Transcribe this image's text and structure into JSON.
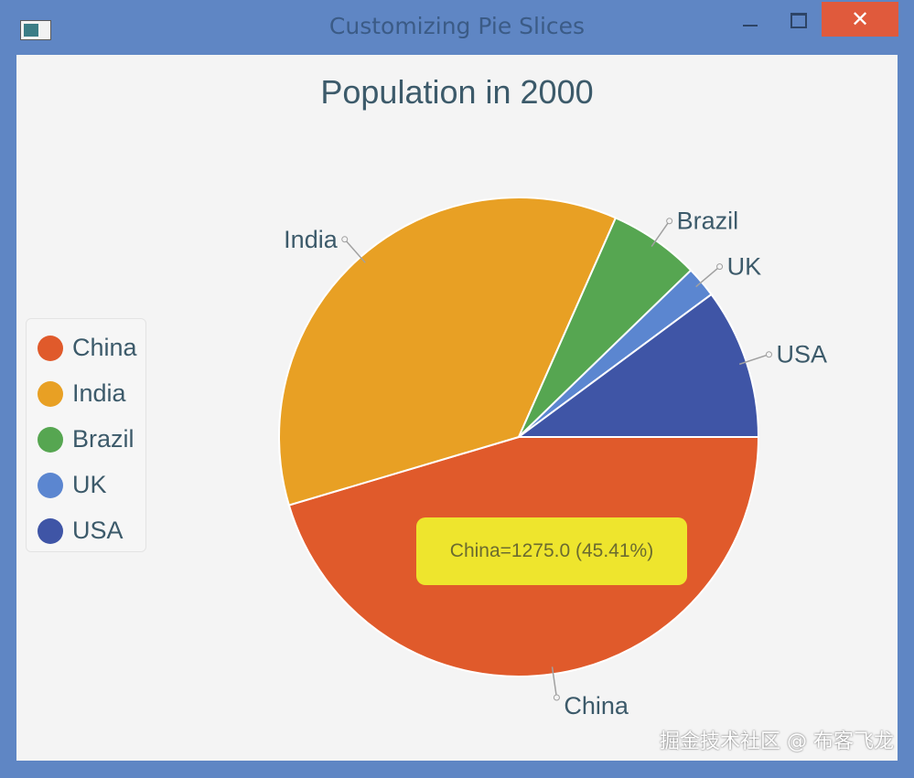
{
  "window": {
    "title": "Customizing Pie Slices",
    "close_glyph": "✕"
  },
  "chart_data": {
    "type": "pie",
    "title": "Population in 2000",
    "categories": [
      "China",
      "India",
      "Brazil",
      "UK",
      "USA"
    ],
    "values": [
      1275.0,
      1017.0,
      172.0,
      59.0,
      285.0
    ],
    "colors": [
      "#e05a2b",
      "#e8a024",
      "#56a651",
      "#5b86d0",
      "#3f55a6"
    ],
    "legend": "left",
    "tooltip": "China=1275.0 (45.41%)"
  },
  "legend": {
    "items": [
      {
        "label": "China",
        "color": "#e05a2b"
      },
      {
        "label": "India",
        "color": "#e8a024"
      },
      {
        "label": "Brazil",
        "color": "#56a651"
      },
      {
        "label": "UK",
        "color": "#5b86d0"
      },
      {
        "label": "USA",
        "color": "#3f55a6"
      }
    ]
  },
  "watermark": "掘金技术社区 @ 布客飞龙"
}
